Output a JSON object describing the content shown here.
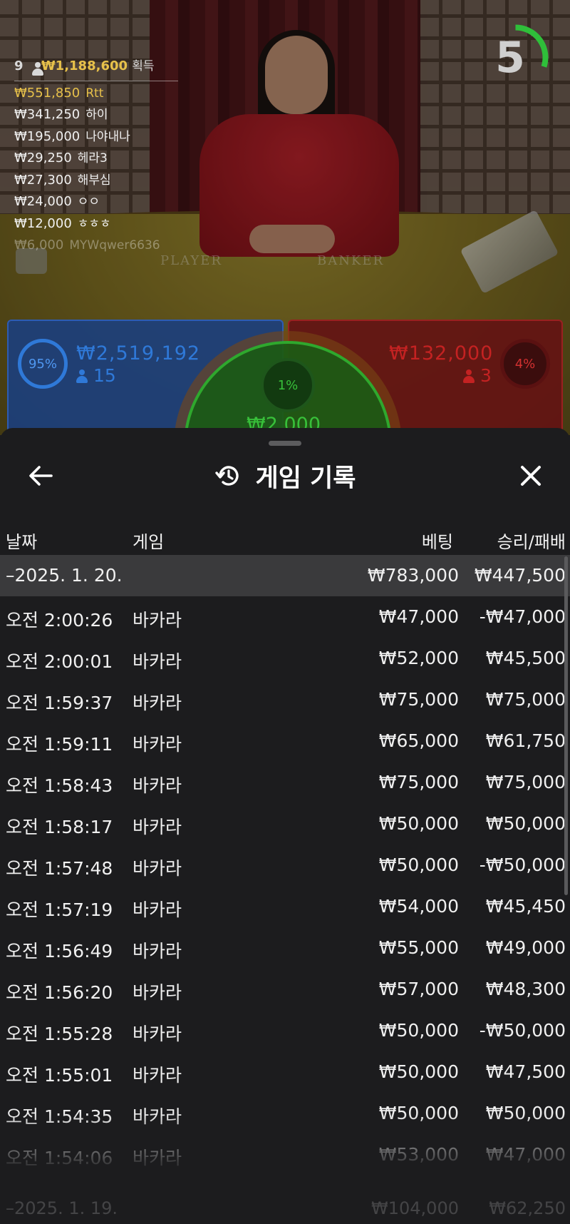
{
  "live": {
    "leaderboard_header": {
      "count": "9",
      "amount": "₩1,188,600",
      "suffix": "획득"
    },
    "leaders": [
      {
        "amount": "₩551,850",
        "name": "Rtt"
      },
      {
        "amount": "₩341,250",
        "name": "하이"
      },
      {
        "amount": "₩195,000",
        "name": "나야내나"
      },
      {
        "amount": "₩29,250",
        "name": "헤라3"
      },
      {
        "amount": "₩27,300",
        "name": "해부심"
      },
      {
        "amount": "₩24,000",
        "name": "ㅇㅇ"
      },
      {
        "amount": "₩12,000",
        "name": "ㅎㅎㅎ"
      },
      {
        "amount": "₩6,000",
        "name": "MYWqwer6636"
      }
    ],
    "countdown": "5",
    "countdown_fraction": 0.3,
    "felt_player": "PLAYER",
    "felt_banker": "BANKER",
    "player": {
      "percent": "95%",
      "amount": "₩2,519,192",
      "players": "15"
    },
    "banker": {
      "percent": "4%",
      "amount": "₩132,000",
      "players": "3"
    },
    "tie": {
      "percent": "1%",
      "amount": "₩2,000"
    },
    "colors": {
      "player": "#2f79d8",
      "banker": "#d23030",
      "tie": "#38c03a",
      "gold": "#e7c14a"
    }
  },
  "sheet": {
    "title": "게임 기록",
    "icons": {
      "back": "arrow-left-icon",
      "history": "history-clock-icon",
      "close": "close-icon"
    },
    "columns": {
      "date": "날짜",
      "game": "게임",
      "bet": "베팅",
      "result": "승리/패배"
    },
    "date_group": {
      "label": "–2025. 1. 20.",
      "bet": "₩783,000",
      "result": "₩447,500"
    },
    "rows": [
      {
        "time": "오전 2:00:26",
        "game": "바카라",
        "bet": "₩47,000",
        "result": "-₩47,000"
      },
      {
        "time": "오전 2:00:01",
        "game": "바카라",
        "bet": "₩52,000",
        "result": "₩45,500"
      },
      {
        "time": "오전 1:59:37",
        "game": "바카라",
        "bet": "₩75,000",
        "result": "₩75,000"
      },
      {
        "time": "오전 1:59:11",
        "game": "바카라",
        "bet": "₩65,000",
        "result": "₩61,750"
      },
      {
        "time": "오전 1:58:43",
        "game": "바카라",
        "bet": "₩75,000",
        "result": "₩75,000"
      },
      {
        "time": "오전 1:58:17",
        "game": "바카라",
        "bet": "₩50,000",
        "result": "₩50,000"
      },
      {
        "time": "오전 1:57:48",
        "game": "바카라",
        "bet": "₩50,000",
        "result": "-₩50,000"
      },
      {
        "time": "오전 1:57:19",
        "game": "바카라",
        "bet": "₩54,000",
        "result": "₩45,450"
      },
      {
        "time": "오전 1:56:49",
        "game": "바카라",
        "bet": "₩55,000",
        "result": "₩49,000"
      },
      {
        "time": "오전 1:56:20",
        "game": "바카라",
        "bet": "₩57,000",
        "result": "₩48,300"
      },
      {
        "time": "오전 1:55:28",
        "game": "바카라",
        "bet": "₩50,000",
        "result": "-₩50,000"
      },
      {
        "time": "오전 1:55:01",
        "game": "바카라",
        "bet": "₩50,000",
        "result": "₩47,500"
      },
      {
        "time": "오전 1:54:35",
        "game": "바카라",
        "bet": "₩50,000",
        "result": "₩50,000"
      },
      {
        "time": "오전 1:54:06",
        "game": "바카라",
        "bet": "₩53,000",
        "result": "₩47,000"
      }
    ],
    "next_group": {
      "label": "–2025. 1. 19.",
      "bet": "₩104,000",
      "result": "₩62,250"
    }
  }
}
